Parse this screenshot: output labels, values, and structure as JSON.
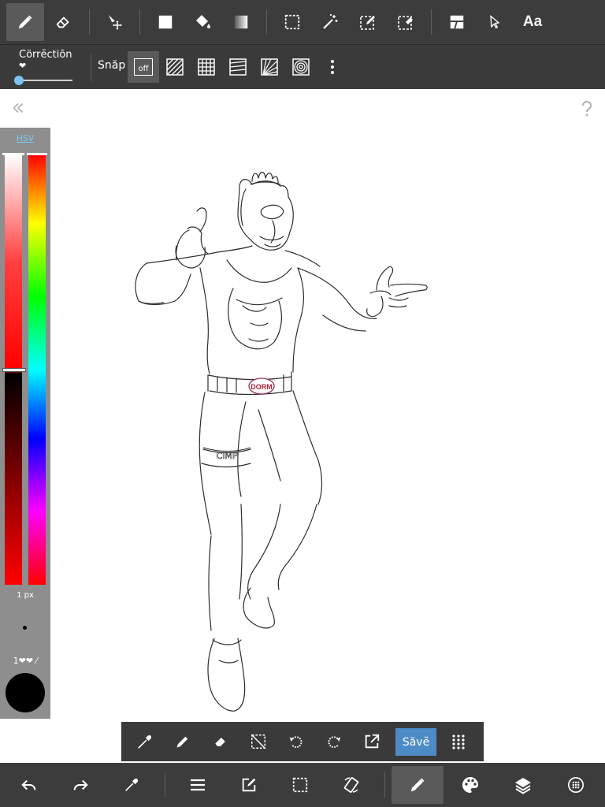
{
  "top_toolbar": {
    "tools": [
      {
        "name": "pen-tool",
        "icon": "pen-icon",
        "active": true
      },
      {
        "name": "eraser-tool",
        "icon": "eraser-icon"
      },
      {
        "name": "move-tool",
        "icon": "move-icon"
      },
      {
        "name": "fill-rect-tool",
        "icon": "square-icon"
      },
      {
        "name": "bucket-tool",
        "icon": "paint-bucket-icon"
      },
      {
        "name": "gradient-tool",
        "icon": "gradient-icon"
      },
      {
        "name": "select-tool",
        "icon": "marquee-icon"
      },
      {
        "name": "magic-wand-tool",
        "icon": "magic-wand-icon"
      },
      {
        "name": "select-pen-tool",
        "icon": "select-pen-icon"
      },
      {
        "name": "select-eraser-tool",
        "icon": "select-eraser-icon"
      },
      {
        "name": "frame-divider-tool",
        "icon": "frame-divider-icon"
      },
      {
        "name": "operation-tool",
        "icon": "cursor-icon"
      }
    ],
    "text_tool_label": "Aa"
  },
  "sub_toolbar": {
    "correction_label": "Cörrĕctiōn",
    "correction_sub": "❤",
    "correction_value": 0,
    "snap_label": "Snăp",
    "snap_off_label": "off",
    "snap_modes": [
      "parallel-snap",
      "grid-snap",
      "horizontal-snap",
      "radial-snap",
      "circle-snap"
    ]
  },
  "color_panel": {
    "mode_label": "HSV",
    "brush_size_label": "1 px",
    "opacity_label": "1❤❤ ⁄",
    "current_color": "#000000",
    "hue_color": "#ff0000",
    "value": 0.5
  },
  "floating_bar": {
    "save_label": "Săvĕ",
    "save_color": "#4d8bc6"
  },
  "bottom_bar": {
    "items": [
      "undo",
      "redo",
      "eyedropper",
      "menu",
      "edit",
      "selection",
      "transform",
      "brush",
      "palette",
      "layers",
      "materials"
    ]
  },
  "canvas": {
    "belt_text": "DORM",
    "leg_text": "CIMP"
  }
}
